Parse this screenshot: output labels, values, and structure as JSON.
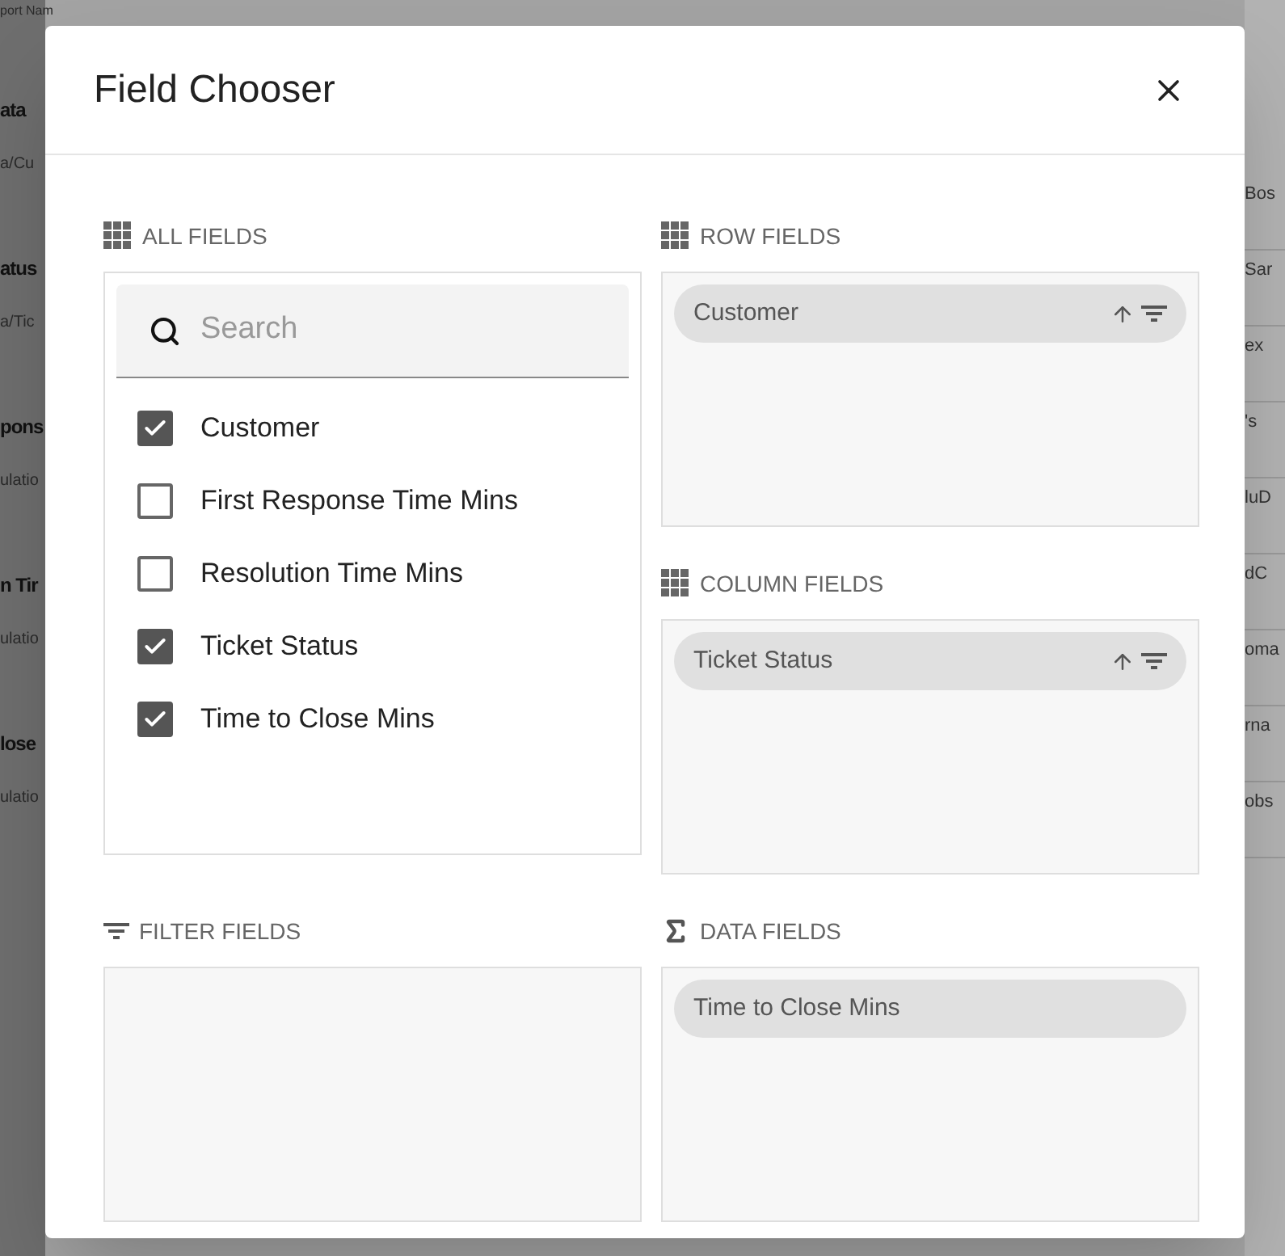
{
  "background": {
    "left_items": [
      {
        "text": "port Nam",
        "kind": "sub"
      },
      {
        "text": "ata",
        "kind": "head"
      },
      {
        "text": "a/Cu",
        "kind": "sub"
      },
      {
        "text": "atus",
        "kind": "head"
      },
      {
        "text": "a/Tic",
        "kind": "sub"
      },
      {
        "text": "pons",
        "kind": "head"
      },
      {
        "text": "ulatio",
        "kind": "sub"
      },
      {
        "text": "n Tir",
        "kind": "head"
      },
      {
        "text": "ulatio",
        "kind": "sub"
      },
      {
        "text": "lose",
        "kind": "head"
      },
      {
        "text": "ulatio",
        "kind": "sub"
      }
    ],
    "right_items": [
      "Bos",
      "Sar",
      "ex",
      "'s",
      "luD",
      "dC",
      "oma",
      "rna",
      "obs"
    ]
  },
  "dialog": {
    "title": "Field Chooser",
    "all_fields": {
      "label": "ALL FIELDS",
      "search": {
        "placeholder": "Search"
      },
      "fields": [
        {
          "name": "Customer",
          "checked": true
        },
        {
          "name": "First Response Time Mins",
          "checked": false
        },
        {
          "name": "Resolution Time Mins",
          "checked": false
        },
        {
          "name": "Ticket Status",
          "checked": true
        },
        {
          "name": "Time to Close Mins",
          "checked": true
        }
      ]
    },
    "zones": [
      {
        "kind": "row",
        "label": "ROW FIELDS",
        "chips": [
          "Customer"
        ]
      },
      {
        "kind": "column",
        "label": "COLUMN FIELDS",
        "chips": [
          "Ticket Status"
        ]
      },
      {
        "kind": "filter",
        "label": "FILTER FIELDS"
      },
      {
        "kind": "data",
        "label": "DATA FIELDS",
        "chips": [
          "Time to Close Mins"
        ]
      }
    ]
  }
}
